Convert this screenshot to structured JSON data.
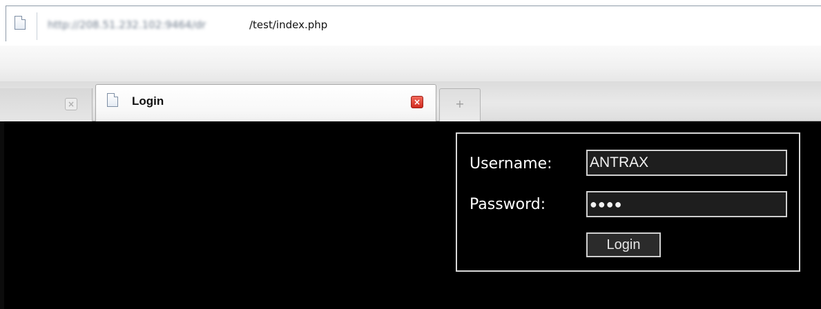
{
  "browser": {
    "address_bar": {
      "url_host_blurred": "http://208.51.232.102:9464/dr",
      "url_path": "/test/index.php"
    },
    "tabs": [
      {
        "label": "",
        "active": false,
        "close_icon": "close-icon"
      },
      {
        "label": "Login",
        "active": true,
        "close_icon": "close-icon"
      }
    ],
    "new_tab_glyph": "+"
  },
  "login_form": {
    "username_label": "Username:",
    "username_value": "ANTRAX",
    "password_label": "Password:",
    "password_value": "●●●●",
    "submit_label": "Login"
  },
  "colors": {
    "page_background": "#000000",
    "panel_border": "#d8d8d8",
    "input_background": "#1e1e1e",
    "close_active": "#d12a1e"
  }
}
